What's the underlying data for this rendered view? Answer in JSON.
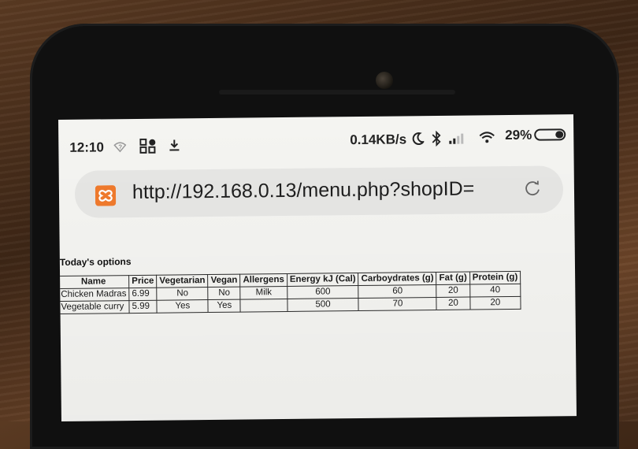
{
  "status_bar": {
    "time": "12:10",
    "network_speed": "0.14KB/s",
    "battery_percent": "29%",
    "battery_level": 0.29,
    "icons": [
      "wifi-question-icon",
      "qr-grid-icon",
      "download-icon",
      "moon-icon",
      "bluetooth-icon",
      "signal-icon",
      "wifi-icon",
      "battery-icon"
    ]
  },
  "browser": {
    "url": "http://192.168.0.13/menu.php?shopID=",
    "site_icon": "xampp-logo-icon",
    "reload_icon": "reload-icon"
  },
  "page": {
    "heading": "Today's options",
    "table": {
      "columns": [
        "Name",
        "Price",
        "Vegetarian",
        "Vegan",
        "Allergens",
        "Energy kJ (Cal)",
        "Carboydrates (g)",
        "Fat (g)",
        "Protein (g)"
      ],
      "rows": [
        [
          "Chicken Madras",
          "6.99",
          "No",
          "No",
          "Milk",
          "600",
          "60",
          "20",
          "40"
        ],
        [
          "Vegetable curry",
          "5.99",
          "Yes",
          "Yes",
          "",
          "500",
          "70",
          "20",
          "20"
        ]
      ]
    }
  },
  "colors": {
    "screen": "#f4f4f1",
    "address_bar": "#e6e6e4",
    "site_icon": "#f07a2c"
  }
}
